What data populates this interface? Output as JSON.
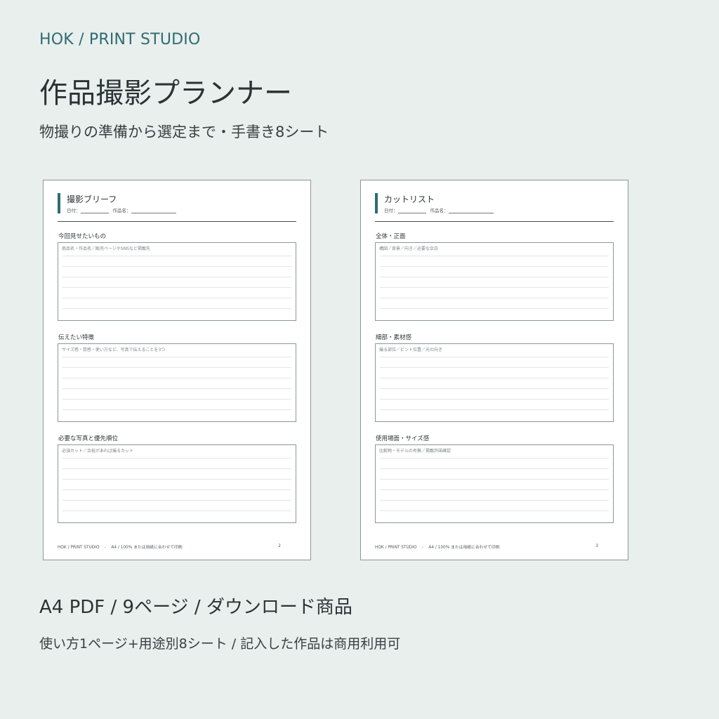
{
  "header": {
    "brand": "HOK / PRINT STUDIO",
    "title": "作品撮影プランナー",
    "subtitle": "物撮りの準備から選定まで・手書き8シート"
  },
  "colors": {
    "background": "#e9efed",
    "accent": "#2f6c72",
    "text": "#2c3437"
  },
  "meta_labels": {
    "date": "日付：",
    "work_name": "作品名："
  },
  "sheets": [
    {
      "title": "撮影ブリーフ",
      "sections": [
        {
          "label": "今回見せたいもの",
          "hint": "商品名・作品名／販売ページやSNSなど掲載先"
        },
        {
          "label": "伝えたい特徴",
          "hint": "サイズ感・質感・使い方など、写真で伝えることを3つ"
        },
        {
          "label": "必要な写真と優先順位",
          "hint": "必須カット／余裕があれば撮るカット"
        }
      ],
      "footer_brand": "HOK / PRINT STUDIO",
      "footer_sep": "-",
      "footer_note": "A4 / 100% または用紙に合わせて印刷",
      "page": "2"
    },
    {
      "title": "カットリスト",
      "sections": [
        {
          "label": "全体・正面",
          "hint": "構図／背景／向き／必要な余白"
        },
        {
          "label": "細部・素材感",
          "hint": "撮る部位／ピント位置／光の向き"
        },
        {
          "label": "使用場面・サイズ感",
          "hint": "比較物・モデルの有無／掲載許諾確認"
        }
      ],
      "footer_brand": "HOK / PRINT STUDIO",
      "footer_sep": "-",
      "footer_note": "A4 / 100% または用紙に合わせて印刷",
      "page": "3"
    }
  ],
  "footer": {
    "main": "A4 PDF / 9ページ / ダウンロード商品",
    "sub": "使い方1ページ+用途別8シート / 記入した作品は商用利用可"
  }
}
